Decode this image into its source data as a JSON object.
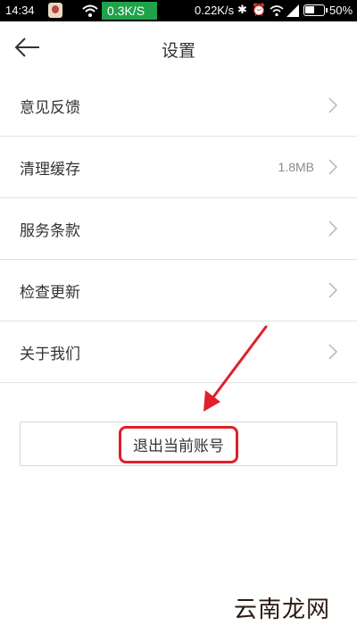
{
  "status_bar": {
    "time": "14:34",
    "speed_left": "0.3K/S",
    "speed_right": "0.22K/s",
    "battery": "50%",
    "accent_color": "#1fa24a"
  },
  "header": {
    "title": "设置",
    "back_icon": "arrow-left-icon"
  },
  "settings": {
    "items": [
      {
        "label": "意见反馈",
        "value": ""
      },
      {
        "label": "清理缓存",
        "value": "1.8MB"
      },
      {
        "label": "服务条款",
        "value": ""
      },
      {
        "label": "检查更新",
        "value": ""
      },
      {
        "label": "关于我们",
        "value": ""
      }
    ]
  },
  "logout": {
    "label": "退出当前账号",
    "highlight_color": "#e0202c"
  },
  "watermark": "云南龙网"
}
